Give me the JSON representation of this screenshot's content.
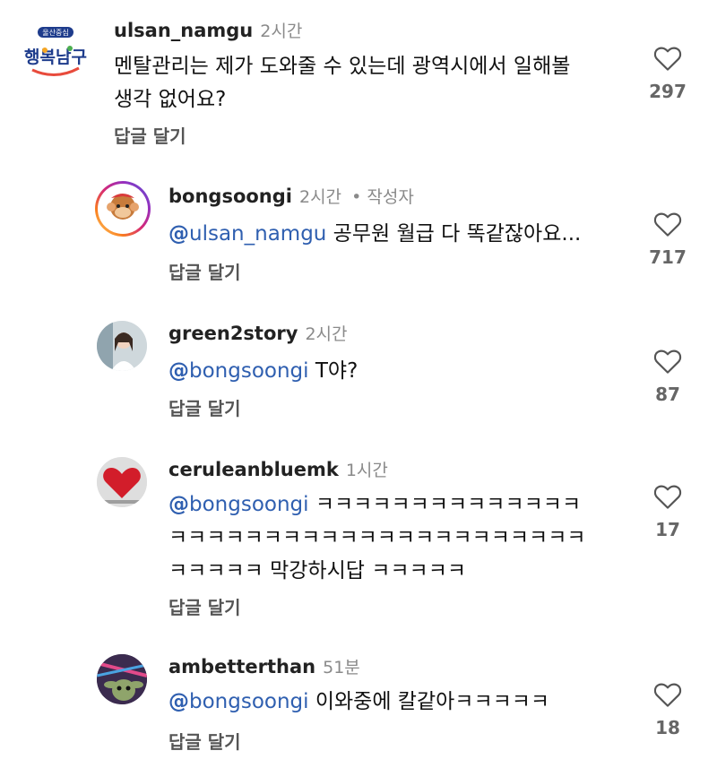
{
  "comments": [
    {
      "user": "ulsan_namgu",
      "time": "2시간",
      "avatar_text": "행복남구",
      "avatar_small": "울산중심",
      "lines": [
        "멘탈관리는 제가 도와줄 수 있는데 광역시에서 일해볼",
        "생각 없어요?"
      ],
      "reply": "답글 달기",
      "likes": "297"
    },
    {
      "user": "bongsoongi",
      "time": "2시간",
      "author": "• 작성자",
      "mention": "@ulsan_namgu",
      "text": " 공무원 월급 다 똑같잖아요...",
      "reply": "답글 달기",
      "likes": "717"
    },
    {
      "user": "green2story",
      "time": "2시간",
      "mention": "@bongsoongi",
      "text": " T야?",
      "reply": "답글 달기",
      "likes": "87"
    },
    {
      "user": "ceruleanbluemk",
      "time": "1시간",
      "mention": "@bongsoongi",
      "line1": " ㅋㅋㅋㅋㅋㅋㅋㅋㅋㅋㅋㅋㅋㅋ",
      "line2": "ㅋㅋㅋㅋㅋㅋㅋㅋㅋㅋㅋㅋㅋㅋㅋㅋㅋㅋㅋㅋㅋㅋ",
      "line3": "ㅋㅋㅋㅋㅋ 막강하시답 ㅋㅋㅋㅋㅋ",
      "reply": "답글 달기",
      "likes": "17"
    },
    {
      "user": "ambetterthan",
      "time": "51분",
      "mention": "@bongsoongi",
      "text": " 이와중에 칼같아ㅋㅋㅋㅋㅋ",
      "reply": "답글 달기",
      "likes": "18"
    }
  ],
  "colors": {
    "mention": "#2f5fb0",
    "meta": "#8a8a8a"
  },
  "icons": {
    "like": "heart-outline-icon",
    "mention_prefix": "threads-at-icon"
  }
}
